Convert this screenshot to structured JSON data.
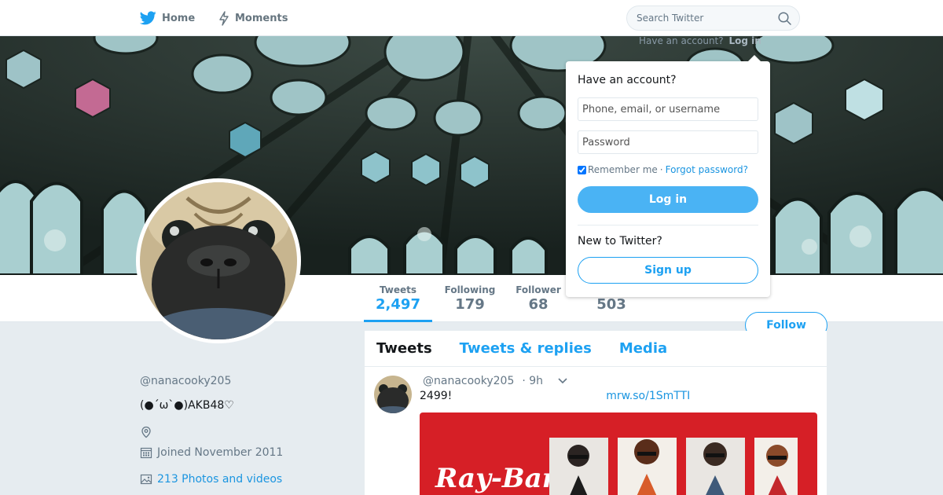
{
  "nav": {
    "home_label": "Home",
    "moments_label": "Moments",
    "search_placeholder": "Search Twitter",
    "brand_color": "#1da1f2"
  },
  "login_prompt": {
    "text": "Have an account?",
    "link": "Log in"
  },
  "login_popup": {
    "title": "Have an account?",
    "username_placeholder": "Phone, email, or username",
    "password_placeholder": "Password",
    "remember_label": "Remember me",
    "separator": "·",
    "forgot_label": "Forgot password?",
    "login_button": "Log in",
    "new_to_label": "New to Twitter?",
    "signup_button": "Sign up"
  },
  "profile": {
    "name": "",
    "handle": "@nanacooky205",
    "bio": "(●´ω`●)AKB48♡",
    "location": "",
    "joined": "Joined November 2011",
    "photos_label": "213 Photos and videos"
  },
  "stats": {
    "tweets_label": "Tweets",
    "tweets_value": "2,497",
    "following_label": "Following",
    "following_value": "179",
    "followers_label": "Follower",
    "followers_value": "68",
    "likes_value": "503"
  },
  "follow_button": "Follow",
  "timeline": {
    "tabs": [
      "Tweets",
      "Tweets & replies",
      "Media"
    ],
    "tweet": {
      "handle": "@nanacooky205",
      "time": "· 9h",
      "text": "2499!",
      "link": "mrw.so/1SmTTI",
      "media_brand": "Ray-Ban"
    }
  }
}
